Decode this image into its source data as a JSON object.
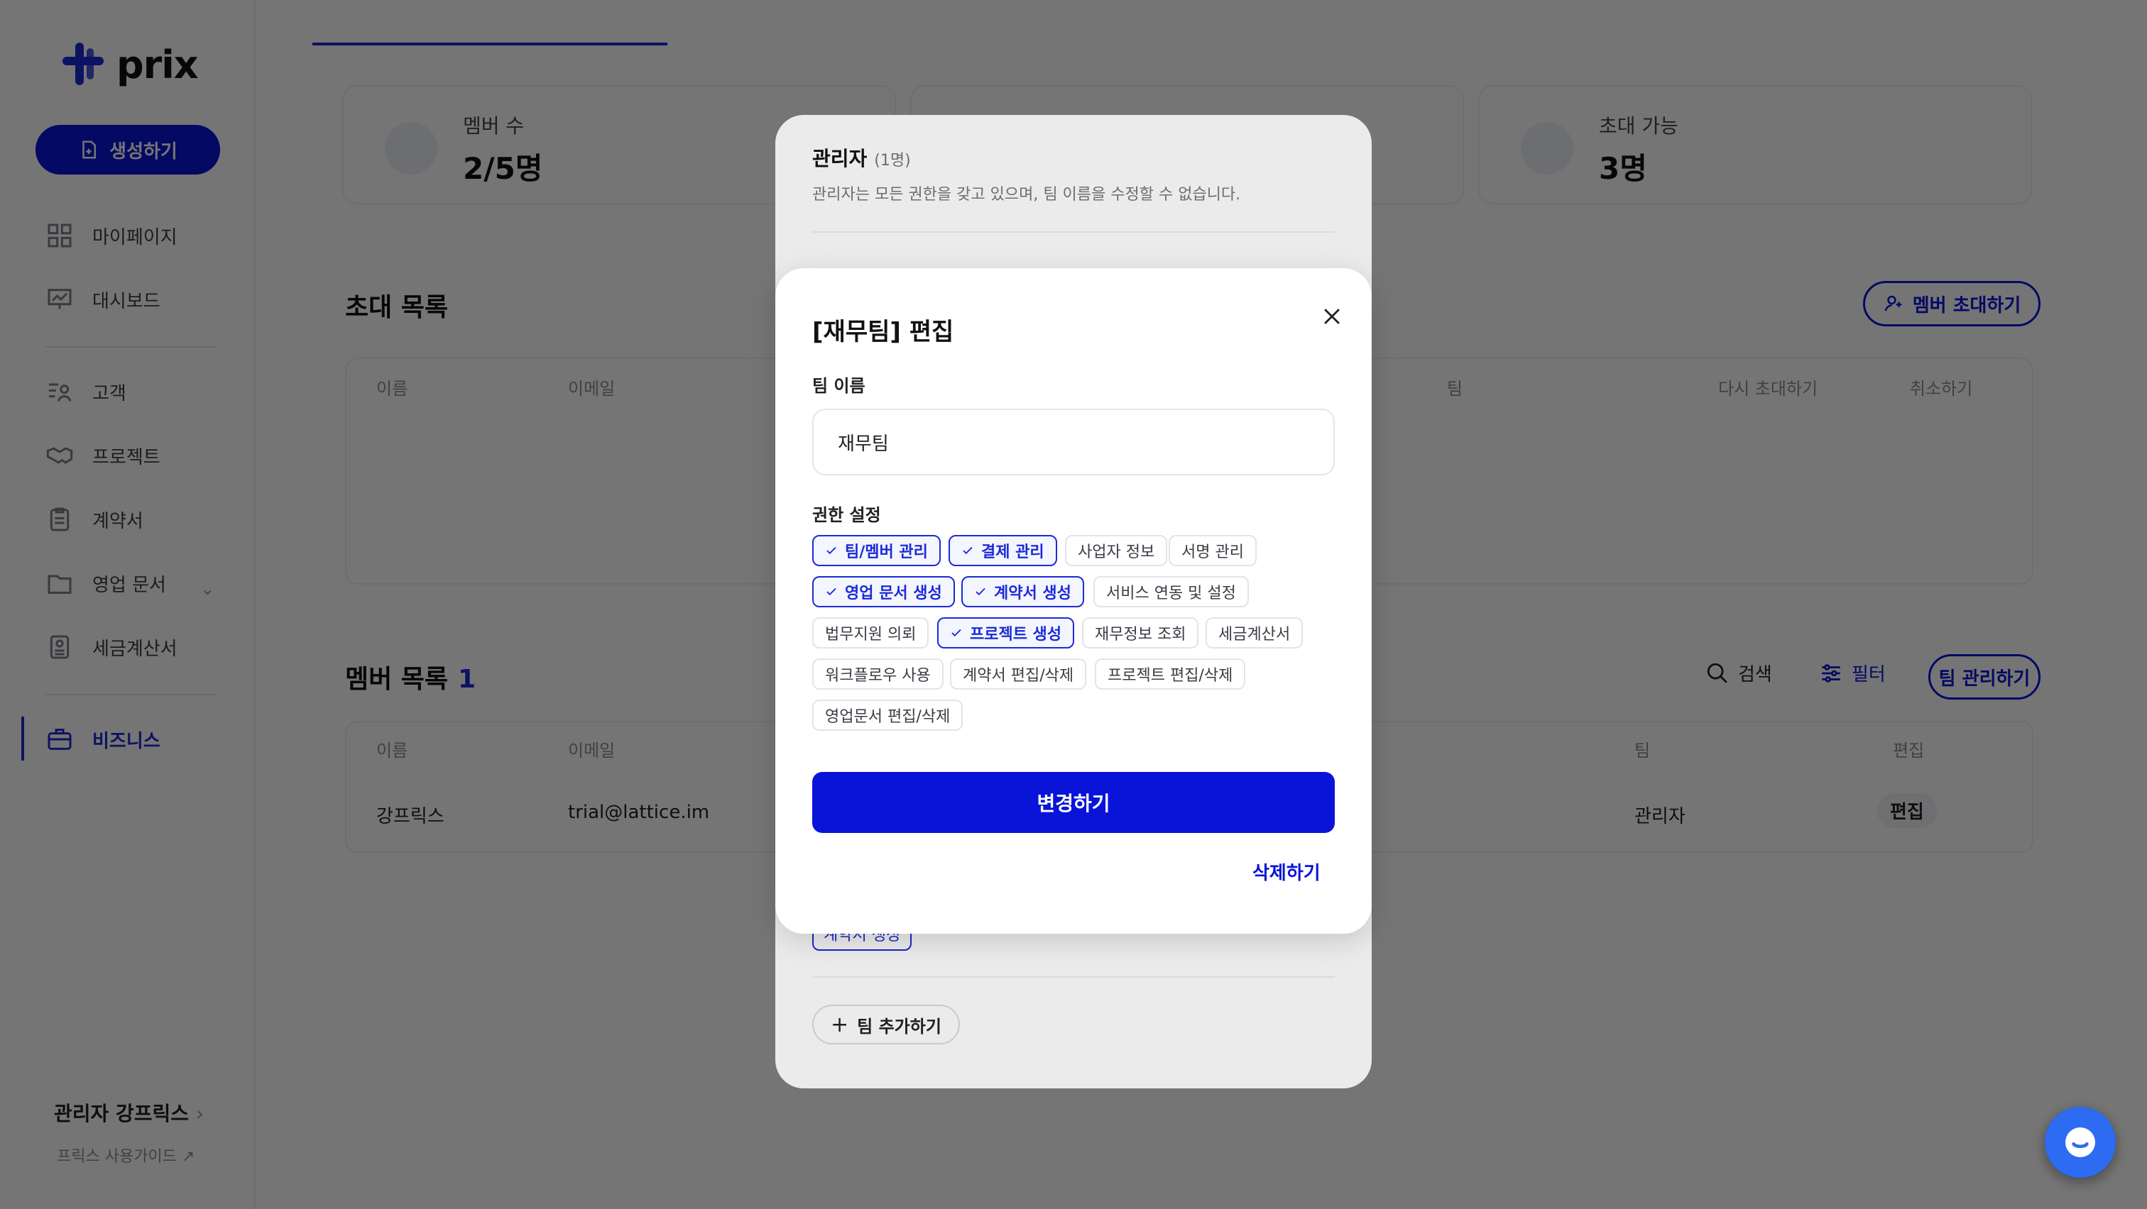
{
  "app": {
    "logo_text": "prix"
  },
  "sidebar": {
    "create_label": "생성하기",
    "items": [
      {
        "label": "마이페이지",
        "icon": "grid-icon"
      },
      {
        "label": "대시보드",
        "icon": "presentation-icon"
      },
      {
        "label": "고객",
        "icon": "customers-icon"
      },
      {
        "label": "프로젝트",
        "icon": "handshake-icon"
      },
      {
        "label": "계약서",
        "icon": "clipboard-icon"
      },
      {
        "label": "영업 문서",
        "icon": "folder-icon"
      },
      {
        "label": "세금계산서",
        "icon": "receipt-icon"
      },
      {
        "label": "비즈니스",
        "icon": "briefcase-icon"
      }
    ],
    "active": "비즈니스",
    "admin_label": "관리자 강프릭스",
    "guide_label": "프릭스 사용가이드"
  },
  "main": {
    "stats": [
      {
        "label": "멤버 수",
        "value": "2/5명"
      },
      {
        "label": "초대 가능",
        "value": "3명"
      }
    ],
    "invite_section": {
      "title": "초대 목록",
      "invite_button": "멤버 초대하기",
      "headers": [
        "이름",
        "이메일",
        "팀",
        "다시 초대하기",
        "취소하기"
      ]
    },
    "member_section": {
      "title": "멤버 목록",
      "count": "1",
      "search_label": "검색",
      "filter_label": "필터",
      "manage_button": "팀 관리하기",
      "headers": [
        "이름",
        "이메일",
        "팀",
        "편집"
      ],
      "rows": [
        {
          "name": "강프릭스",
          "email": "trial@lattice.im",
          "team": "관리자",
          "edit": "편집"
        }
      ]
    }
  },
  "team_modal": {
    "admin_title": "관리자",
    "admin_count": "(1명)",
    "admin_desc": "관리자는 모든 권한을 갖고 있으며, 팀 이름을 수정할 수 없습니다.",
    "partial_chip": "계약서 생성",
    "add_team": "팀 추가하기"
  },
  "edit_modal": {
    "title": "[재무팀] 편집",
    "team_name_label": "팀 이름",
    "team_name_value": "재무팀",
    "permission_label": "권한 설정",
    "permissions": [
      {
        "label": "팀/멤버 관리",
        "checked": true
      },
      {
        "label": "결제 관리",
        "checked": true
      },
      {
        "label": "사업자 정보",
        "checked": false
      },
      {
        "label": "서명 관리",
        "checked": false
      },
      {
        "label": "영업 문서 생성",
        "checked": true
      },
      {
        "label": "계약서 생성",
        "checked": true
      },
      {
        "label": "서비스 연동 및 설정",
        "checked": false
      },
      {
        "label": "법무지원 의뢰",
        "checked": false
      },
      {
        "label": "프로젝트 생성",
        "checked": true
      },
      {
        "label": "재무정보 조회",
        "checked": false
      },
      {
        "label": "세금계산서",
        "checked": false
      },
      {
        "label": "워크플로우 사용",
        "checked": false
      },
      {
        "label": "계약서 편집/삭제",
        "checked": false
      },
      {
        "label": "프로젝트 편집/삭제",
        "checked": false
      },
      {
        "label": "영업문서 편집/삭제",
        "checked": false
      }
    ],
    "submit_label": "변경하기",
    "delete_label": "삭제하기"
  },
  "colors": {
    "brand": "#0a14d8",
    "overlay": "rgba(0,0,0,0.5)"
  }
}
